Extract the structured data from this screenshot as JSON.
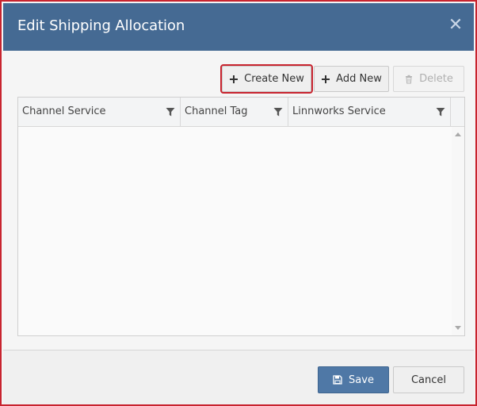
{
  "dialog": {
    "title": "Edit Shipping Allocation",
    "close_glyph": "✕"
  },
  "toolbar": {
    "create_new_label": "Create New",
    "add_new_label": "Add New",
    "delete_label": "Delete"
  },
  "grid": {
    "columns": [
      {
        "label": "Channel Service"
      },
      {
        "label": "Channel Tag"
      },
      {
        "label": "Linnworks Service"
      }
    ],
    "rows": []
  },
  "footer": {
    "save_label": "Save",
    "cancel_label": "Cancel"
  },
  "colors": {
    "header_bg": "#456a93",
    "primary_button": "#4f78a6",
    "highlight": "#c8242f"
  }
}
